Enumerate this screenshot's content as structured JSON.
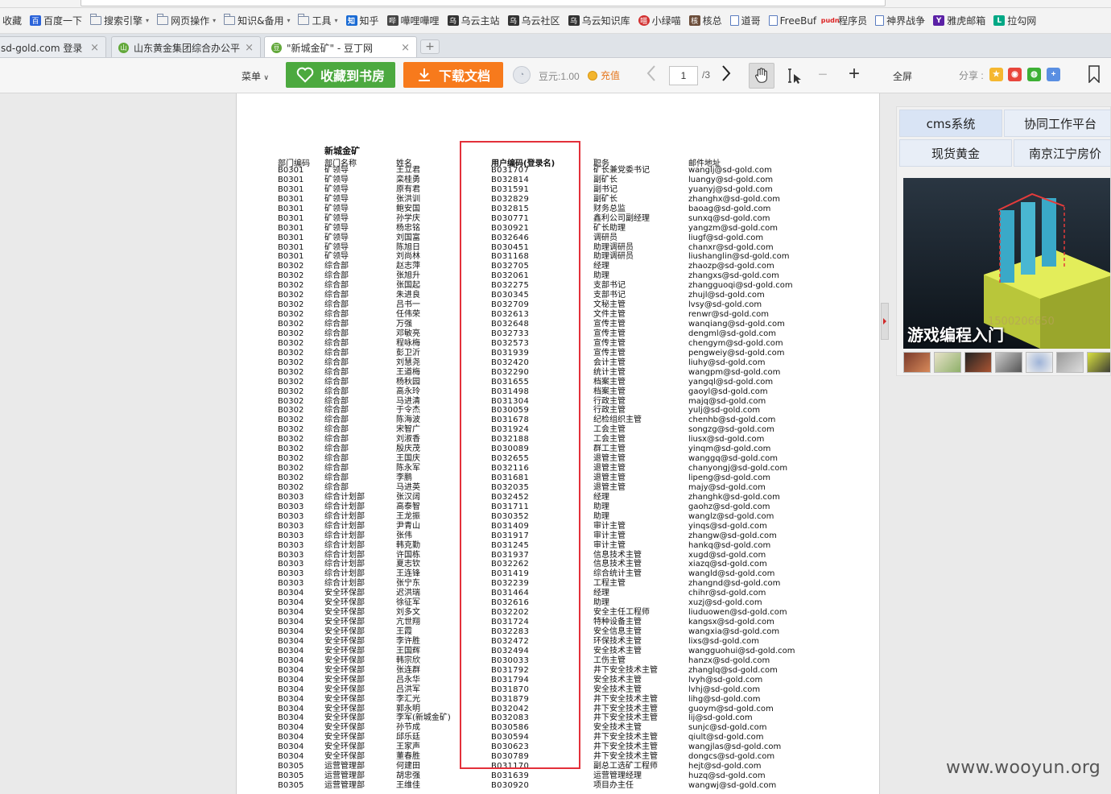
{
  "browser": {
    "address_url": "http://www.docin.com/p-1204478050.html",
    "bookmarks": [
      {
        "label": "收藏",
        "icon": "star-icon",
        "dropdown": false
      },
      {
        "label": "百度一下",
        "icon": "baidu-icon",
        "dropdown": false
      },
      {
        "label": "搜索引擎",
        "icon": "folder-icon",
        "dropdown": true
      },
      {
        "label": "网页操作",
        "icon": "folder-icon",
        "dropdown": true
      },
      {
        "label": "知识&备用",
        "icon": "folder-icon",
        "dropdown": true
      },
      {
        "label": "工具",
        "icon": "folder-icon",
        "dropdown": true
      },
      {
        "label": "知乎",
        "icon": "zhihu-icon",
        "dropdown": false
      },
      {
        "label": "嘩哩嘩哩",
        "icon": "bilibili-icon",
        "dropdown": false
      },
      {
        "label": "乌云主站",
        "icon": "wooyun-icon",
        "dropdown": false
      },
      {
        "label": "乌云社区",
        "icon": "wooyun-icon",
        "dropdown": false
      },
      {
        "label": "乌云知识库",
        "icon": "wooyun-icon",
        "dropdown": false
      },
      {
        "label": "小绿喵",
        "icon": "cat-icon",
        "dropdown": false
      },
      {
        "label": "核总",
        "icon": "avatar-icon",
        "dropdown": false
      },
      {
        "label": "道哥",
        "icon": "page-icon",
        "dropdown": false
      },
      {
        "label": "FreeBuf",
        "icon": "page-icon",
        "dropdown": false
      },
      {
        "label": "程序员",
        "icon": "pudn-icon",
        "dropdown": false
      },
      {
        "label": "神界战争",
        "icon": "page-icon",
        "dropdown": false
      },
      {
        "label": "雅虎邮箱",
        "icon": "yahoo-icon",
        "dropdown": false
      },
      {
        "label": "拉勾网",
        "icon": "lagou-icon",
        "dropdown": false
      }
    ],
    "tabs": [
      {
        "label": "sd-gold.com 登录",
        "active": false
      },
      {
        "label": "山东黄金集团综合办公平",
        "active": false
      },
      {
        "label": "\"新城金矿\" - 豆丁网",
        "active": true
      }
    ],
    "new_tab": "+"
  },
  "toolbar": {
    "menu_label": "菜单",
    "favorite_label": "收藏到书房",
    "download_label": "下载文档",
    "douyuan_label": "豆元:1.00",
    "recharge_label": "充值",
    "current_page": "1",
    "total_pages": "/3",
    "fullscreen_label": "全屏",
    "share_label": "分享 :"
  },
  "document": {
    "sheet_title": "新城金矿",
    "headers": {
      "dept_code": "部门编码",
      "dept_name": "部门名称",
      "person": "姓名",
      "user_code": "用户编码(登录名)",
      "position": "职务",
      "email": "邮件地址"
    },
    "rows": [
      [
        "B0301",
        "矿领导",
        "王立君",
        "B031707",
        "矿长兼党委书记",
        "wanglj@sd-gold.com"
      ],
      [
        "B0301",
        "矿领导",
        "栾桂勇",
        "B032814",
        "副矿长",
        "luangy@sd-gold.com"
      ],
      [
        "B0301",
        "矿领导",
        "原有君",
        "B031591",
        "副书记",
        "yuanyj@sd-gold.com"
      ],
      [
        "B0301",
        "矿领导",
        "张洪训",
        "B032829",
        "副矿长",
        "zhanghx@sd-gold.com"
      ],
      [
        "B0301",
        "矿领导",
        "鲍安国",
        "B032815",
        "财务总监",
        "baoag@sd-gold.com"
      ],
      [
        "B0301",
        "矿领导",
        "孙学庆",
        "B030771",
        "鑫利公司副经理",
        "sunxq@sd-gold.com"
      ],
      [
        "B0301",
        "矿领导",
        "杨忠铭",
        "B030921",
        "矿长助理",
        "yangzm@sd-gold.com"
      ],
      [
        "B0301",
        "矿领导",
        "刘国富",
        "B032646",
        "调研员",
        "liugf@sd-gold.com"
      ],
      [
        "B0301",
        "矿领导",
        "陈旭日",
        "B030451",
        "助理调研员",
        "chanxr@sd-gold.com"
      ],
      [
        "B0301",
        "矿领导",
        "刘尚林",
        "B031168",
        "助理调研员",
        "liushanglin@sd-gold.com"
      ],
      [
        "B0302",
        "综合部",
        "赵志萍",
        "B032705",
        "经理",
        "zhaozp@sd-gold.com"
      ],
      [
        "B0302",
        "综合部",
        "张旭升",
        "B032061",
        "助理",
        "zhangxs@sd-gold.com"
      ],
      [
        "B0302",
        "综合部",
        "张国起",
        "B032275",
        "支部书记",
        "zhangguoqi@sd-gold.com"
      ],
      [
        "B0302",
        "综合部",
        "朱进良",
        "B030345",
        "支部书记",
        "zhujl@sd-gold.com"
      ],
      [
        "B0302",
        "综合部",
        "吕书一",
        "B032709",
        "文秘主管",
        "lvsy@sd-gold.com"
      ],
      [
        "B0302",
        "综合部",
        "任伟荣",
        "B032613",
        "文件主管",
        "renwr@sd-gold.com"
      ],
      [
        "B0302",
        "综合部",
        "万强",
        "B032648",
        "宣传主管",
        "wanqiang@sd-gold.com"
      ],
      [
        "B0302",
        "综合部",
        "邓敏亮",
        "B032733",
        "宣传主管",
        "dengml@sd-gold.com"
      ],
      [
        "B0302",
        "综合部",
        "程咏梅",
        "B032573",
        "宣传主管",
        "chengym@sd-gold.com"
      ],
      [
        "B0302",
        "综合部",
        "彭卫沂",
        "B031939",
        "宣传主管",
        "pengweiy@sd-gold.com"
      ],
      [
        "B0302",
        "综合部",
        "刘慧尧",
        "B032420",
        "会计主管",
        "liuhy@sd-gold.com"
      ],
      [
        "B0302",
        "综合部",
        "王道梅",
        "B032290",
        "统计主管",
        "wangpm@sd-gold.com"
      ],
      [
        "B0302",
        "综合部",
        "杨秋园",
        "B031655",
        "档案主管",
        "yangql@sd-gold.com"
      ],
      [
        "B0302",
        "综合部",
        "高永玲",
        "B031498",
        "档案主管",
        "gaoyl@sd-gold.com"
      ],
      [
        "B0302",
        "综合部",
        "马进清",
        "B031304",
        "行政主管",
        "majq@sd-gold.com"
      ],
      [
        "B0302",
        "综合部",
        "于令杰",
        "B030059",
        "行政主管",
        "yulj@sd-gold.com"
      ],
      [
        "B0302",
        "综合部",
        "陈海波",
        "B031678",
        "纪检组织主管",
        "chenhb@sd-gold.com"
      ],
      [
        "B0302",
        "综合部",
        "宋智广",
        "B031924",
        "工会主管",
        "songzg@sd-gold.com"
      ],
      [
        "B0302",
        "综合部",
        "刘淑香",
        "B032188",
        "工会主管",
        "liusx@sd-gold.com"
      ],
      [
        "B0302",
        "综合部",
        "殷庆茂",
        "B030089",
        "群工主管",
        "yinqm@sd-gold.com"
      ],
      [
        "B0302",
        "综合部",
        "王国庆",
        "B032655",
        "退管主管",
        "wanggq@sd-gold.com"
      ],
      [
        "B0302",
        "综合部",
        "陈永军",
        "B032116",
        "退管主管",
        "chanyongj@sd-gold.com"
      ],
      [
        "B0302",
        "综合部",
        "李鹏",
        "B031681",
        "退管主管",
        "lipeng@sd-gold.com"
      ],
      [
        "B0302",
        "综合部",
        "马进英",
        "B032035",
        "退管主管",
        "majy@sd-gold.com"
      ],
      [
        "B0303",
        "综合计划部",
        "张汉阔",
        "B032452",
        "经理",
        "zhanghk@sd-gold.com"
      ],
      [
        "B0303",
        "综合计划部",
        "高泰智",
        "B031711",
        "助理",
        "gaohz@sd-gold.com"
      ],
      [
        "B0303",
        "综合计划部",
        "王龙振",
        "B030352",
        "助理",
        "wanglz@sd-gold.com"
      ],
      [
        "B0303",
        "综合计划部",
        "尹青山",
        "B031409",
        "审计主管",
        "yinqs@sd-gold.com"
      ],
      [
        "B0303",
        "综合计划部",
        "张伟",
        "B031917",
        "审计主管",
        "zhangw@sd-gold.com"
      ],
      [
        "B0303",
        "综合计划部",
        "韩克勤",
        "B031245",
        "审计主管",
        "hankq@sd-gold.com"
      ],
      [
        "B0303",
        "综合计划部",
        "许国栋",
        "B031937",
        "信息技术主管",
        "xugd@sd-gold.com"
      ],
      [
        "B0303",
        "综合计划部",
        "夏志钦",
        "B032262",
        "信息技术主管",
        "xiazq@sd-gold.com"
      ],
      [
        "B0303",
        "综合计划部",
        "王连锋",
        "B031419",
        "综合统计主管",
        "wangld@sd-gold.com"
      ],
      [
        "B0303",
        "综合计划部",
        "张宁东",
        "B032239",
        "工程主管",
        "zhangnd@sd-gold.com"
      ],
      [
        "B0304",
        "安全环保部",
        "迟洪瑞",
        "B031464",
        "经理",
        "chihr@sd-gold.com"
      ],
      [
        "B0304",
        "安全环保部",
        "徐征军",
        "B032616",
        "助理",
        "xuzj@sd-gold.com"
      ],
      [
        "B0304",
        "安全环保部",
        "刘多文",
        "B032202",
        "安全主任工程师",
        "liuduowen@sd-gold.com"
      ],
      [
        "B0304",
        "安全环保部",
        "亢世翔",
        "B031724",
        "特种设备主管",
        "kangsx@sd-gold.com"
      ],
      [
        "B0304",
        "安全环保部",
        "王霞",
        "B032283",
        "安全信息主管",
        "wangxia@sd-gold.com"
      ],
      [
        "B0304",
        "安全环保部",
        "李许胜",
        "B032472",
        "环保技术主管",
        "lixs@sd-gold.com"
      ],
      [
        "B0304",
        "安全环保部",
        "王国辉",
        "B032494",
        "安全技术主管",
        "wangguohui@sd-gold.com"
      ],
      [
        "B0304",
        "安全环保部",
        "韩宗欣",
        "B030033",
        "工伤主管",
        "hanzx@sd-gold.com"
      ],
      [
        "B0304",
        "安全环保部",
        "张连群",
        "B031792",
        "井下安全技术主管",
        "zhanglq@sd-gold.com"
      ],
      [
        "B0304",
        "安全环保部",
        "吕永华",
        "B031794",
        "安全技术主管",
        "lvyh@sd-gold.com"
      ],
      [
        "B0304",
        "安全环保部",
        "吕洪军",
        "B031870",
        "安全技术主管",
        "lvhj@sd-gold.com"
      ],
      [
        "B0304",
        "安全环保部",
        "李汇光",
        "B031879",
        "井下安全技术主管",
        "lihg@sd-gold.com"
      ],
      [
        "B0304",
        "安全环保部",
        "郭永明",
        "B032042",
        "井下安全技术主管",
        "guoym@sd-gold.com"
      ],
      [
        "B0304",
        "安全环保部",
        "李军(新城金矿)",
        "B032083",
        "井下安全技术主管",
        "lij@sd-gold.com"
      ],
      [
        "B0304",
        "安全环保部",
        "孙节成",
        "B030586",
        "安全技术主管",
        "sunjc@sd-gold.com"
      ],
      [
        "B0304",
        "安全环保部",
        "邱乐廷",
        "B030594",
        "井下安全技术主管",
        "qiult@sd-gold.com"
      ],
      [
        "B0304",
        "安全环保部",
        "王家声",
        "B030623",
        "井下安全技术主管",
        "wangjlas@sd-gold.com"
      ],
      [
        "B0304",
        "安全环保部",
        "董春胜",
        "B030789",
        "井下安全技术主管",
        "dongcs@sd-gold.com"
      ],
      [
        "B0305",
        "运营管理部",
        "何建田",
        "B031170",
        "副总工选矿工程师",
        "hejt@sd-gold.com"
      ],
      [
        "B0305",
        "运营管理部",
        "胡忠强",
        "B031639",
        "运营管理经理",
        "huzq@sd-gold.com"
      ],
      [
        "B0305",
        "运营管理部",
        "王维佳",
        "B030920",
        "项目办主任",
        "wangwj@sd-gold.com"
      ]
    ]
  },
  "sidebar": {
    "tabs": [
      "cms系统",
      "协同工作平台",
      "现货黄金",
      "南京江宁房价"
    ],
    "banner_caption": "游戏编程入门"
  },
  "watermark": "www.wooyun.org",
  "colors": {
    "green_button": "#4ca93f",
    "orange_button": "#f77a1c",
    "highlight_box": "#e3303a",
    "recharge_text": "#e5761c"
  }
}
